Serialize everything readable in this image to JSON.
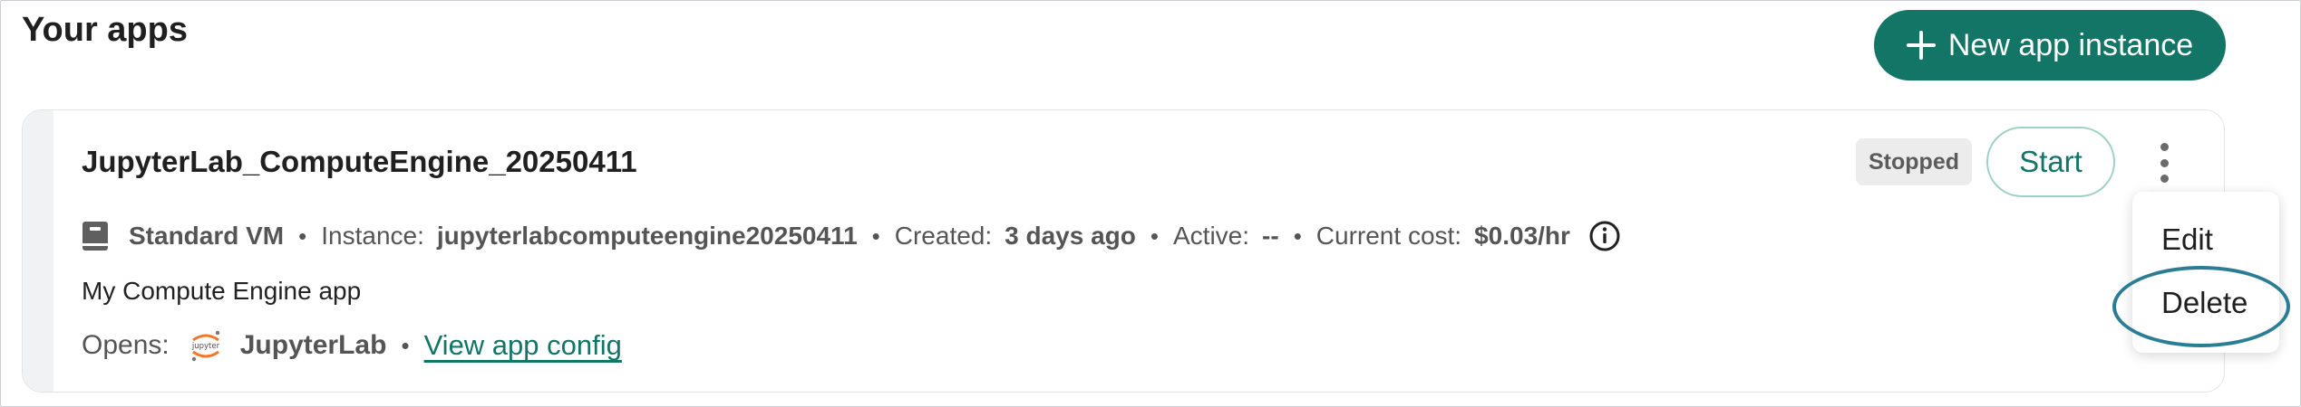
{
  "page": {
    "title": "Your apps",
    "new_button_label": "New app instance"
  },
  "app": {
    "name": "JupyterLab_ComputeEngine_20250411",
    "status": "Stopped",
    "start_label": "Start",
    "meta": {
      "machine": "Standard VM",
      "instance_label": "Instance:",
      "instance_value": "jupyterlabcomputeengine20250411",
      "created_label": "Created:",
      "created_value": "3 days ago",
      "active_label": "Active:",
      "active_value": "--",
      "cost_label": "Current cost:",
      "cost_value": "$0.03/hr",
      "separator": "•"
    },
    "description": "My Compute Engine app",
    "opens_label": "Opens:",
    "opens_app": "JupyterLab",
    "view_config_label": "View app config",
    "logo_text": "jupyter"
  },
  "menu": {
    "items": [
      "Edit",
      "Delete"
    ]
  },
  "colors": {
    "primary": "#127566",
    "badge_bg": "#ececed",
    "highlight": "#2b7d95"
  },
  "icons": {
    "new": "plus-icon",
    "more": "kebab-menu-icon",
    "machine": "server-icon",
    "info": "info-icon",
    "app_logo": "jupyter-logo-icon"
  }
}
